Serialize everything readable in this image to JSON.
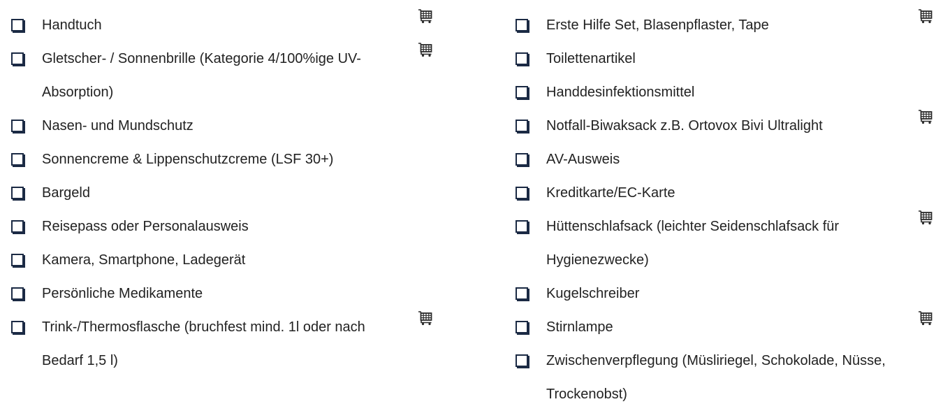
{
  "columns": [
    {
      "items": [
        {
          "label": "Handtuch",
          "cart": true,
          "cart_icon": "shopping-cart-icon"
        },
        {
          "label": "Gletscher- / Sonnenbrille (Kategorie 4/100%ige UV-Absorption)",
          "cart": true,
          "cart_icon": "shopping-cart-icon"
        },
        {
          "label": "Nasen- und Mundschutz",
          "cart": false
        },
        {
          "label": "Sonnencreme & Lippenschutzcreme (LSF 30+)",
          "cart": false
        },
        {
          "label": "Bargeld",
          "cart": false
        },
        {
          "label": "Reisepass oder Personalausweis",
          "cart": false
        },
        {
          "label": "Kamera, Smartphone, Ladegerät",
          "cart": false
        },
        {
          "label": "Persönliche Medikamente",
          "cart": false
        },
        {
          "label": "Trink-/Thermosflasche (bruchfest mind. 1l oder nach Bedarf 1,5 l)",
          "cart": true,
          "cart_icon": "shopping-cart-icon"
        }
      ]
    },
    {
      "items": [
        {
          "label": "Erste Hilfe Set, Blasenpflaster, Tape",
          "cart": true,
          "cart_icon": "shopping-cart-icon"
        },
        {
          "label": "Toilettenartikel",
          "cart": false
        },
        {
          "label": "Handdesinfektionsmittel",
          "cart": false
        },
        {
          "label": "Notfall-Biwaksack z.B. Ortovox Bivi Ultralight",
          "cart": true,
          "cart_icon": "shopping-cart-icon"
        },
        {
          "label": "AV-Ausweis",
          "cart": false
        },
        {
          "label": "Kreditkarte/EC-Karte",
          "cart": false
        },
        {
          "label": "Hüttenschlafsack (leichter Seidenschlafsack für Hygienezwecke)",
          "cart": true,
          "cart_icon": "shopping-cart-icon"
        },
        {
          "label": "Kugelschreiber",
          "cart": false
        },
        {
          "label": "Stirnlampe",
          "cart": true,
          "cart_icon": "shopping-cart-icon"
        },
        {
          "label": "Zwischenverpflegung (Müsliriegel, Schokolade, Nüsse, Trockenobst)",
          "cart": false
        }
      ]
    }
  ],
  "colors": {
    "checkbox_border": "#1b2a44",
    "text": "#222222",
    "cart": "#2a2a2a"
  }
}
